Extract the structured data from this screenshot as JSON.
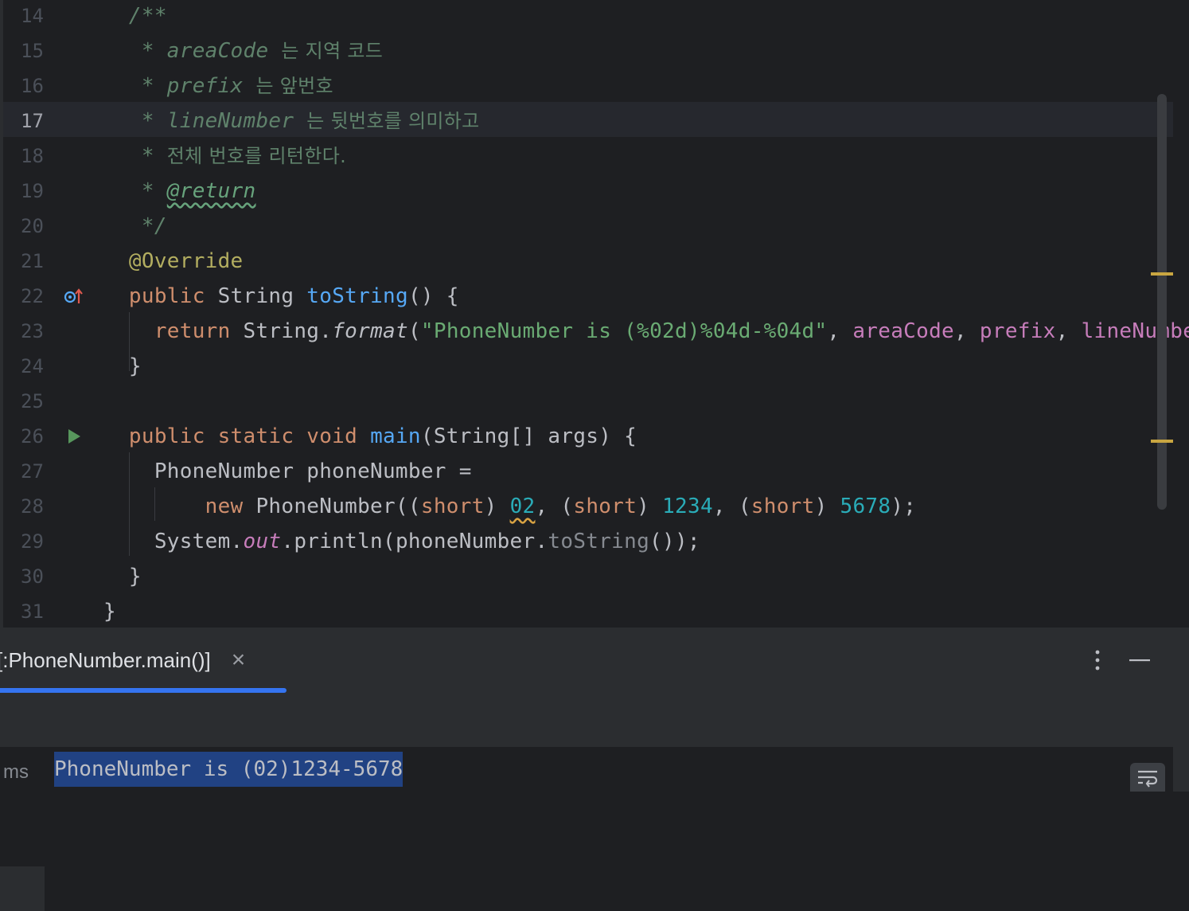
{
  "editor": {
    "current_line": "17",
    "lines": [
      {
        "n": "14",
        "html": "  <span class=\"c-doc\">/**</span>"
      },
      {
        "n": "15",
        "html": "   <span class=\"c-doc\">* areaCode </span><span class=\"c-kr\">는 지역 코드</span>"
      },
      {
        "n": "16",
        "html": "   <span class=\"c-doc\">* prefix </span><span class=\"c-kr\">는 앞번호</span>"
      },
      {
        "n": "17",
        "html": "   <span class=\"c-doc\">* lineNumber </span><span class=\"c-kr\">는 뒷번호를 의미하고</span>"
      },
      {
        "n": "18",
        "html": "   <span class=\"c-doc\">* </span><span class=\"c-kr\">전체 번호를 리턴한다.</span>"
      },
      {
        "n": "19",
        "html": "   <span class=\"c-doc\">* </span><span class=\"c-tag\">@return</span>"
      },
      {
        "n": "20",
        "html": "   <span class=\"c-doc\">*/</span>"
      },
      {
        "n": "21",
        "html": "  <span class=\"c-ann\">@Override</span>"
      },
      {
        "n": "22",
        "html": "  <span class=\"c-kw\">public</span> String <span class=\"c-fn\">toString</span>() {"
      },
      {
        "n": "23",
        "html": "    <span class=\"c-kw\">return</span> String.<span class=\"c-it\">format</span>(<span class=\"c-str\">\"PhoneNumber is (%02d)%04d-%04d\"</span>, <span class=\"c-fld\">areaCode</span>, <span class=\"c-fld\">prefix</span>, <span class=\"c-fld\">lineNumber</span>);"
      },
      {
        "n": "24",
        "html": "  }"
      },
      {
        "n": "25",
        "html": ""
      },
      {
        "n": "26",
        "html": "  <span class=\"c-kw\">public static void</span> <span class=\"c-fn\">main</span>(String[] args) {"
      },
      {
        "n": "27",
        "html": "    PhoneNumber phoneNumber ="
      },
      {
        "n": "28",
        "html": "        <span class=\"c-kw\">new</span> PhoneNumber((<span class=\"c-kw\">short</span>) <span class=\"c-num c-warn\">02</span>, (<span class=\"c-kw\">short</span>) <span class=\"c-num\">1234</span>, (<span class=\"c-kw\">short</span>) <span class=\"c-num\">5678</span>);"
      },
      {
        "n": "29",
        "html": "    System.<span class=\"c-fld-it\">out</span>.println(phoneNumber.<span class=\"c-gray\">toString</span>());"
      },
      {
        "n": "30",
        "html": "  }"
      },
      {
        "n": "31",
        "html": "}"
      }
    ]
  },
  "gutter_icons": {
    "line22": "override-method-icon",
    "line26": "run-icon"
  },
  "run_panel": {
    "tab_label": "[:PhoneNumber.main()]",
    "close_glyph": "×",
    "more_glyph": "⋮",
    "minimize_glyph": "—",
    "time_label": "ms",
    "console_output": "PhoneNumber is (02)1234-5678"
  },
  "colors": {
    "background": "#1e1f22",
    "keyword": "#cf8e6d",
    "function": "#56a8f5",
    "string": "#6aab73",
    "field": "#c77dbb",
    "number": "#2aacb8",
    "doc_comment": "#5f826b",
    "annotation": "#b3ae60",
    "accent": "#3574f0"
  }
}
